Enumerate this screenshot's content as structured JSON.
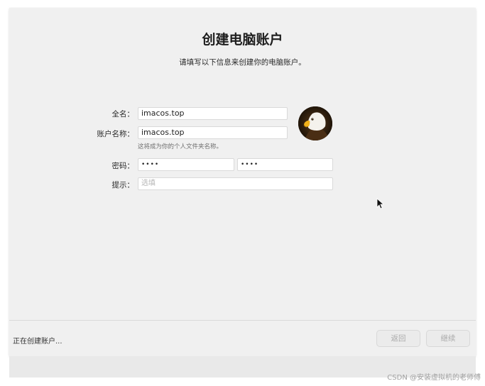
{
  "header": {
    "title": "创建电脑账户",
    "subtitle": "请填写以下信息来创建你的电脑账户。"
  },
  "form": {
    "fullname": {
      "label": "全名：",
      "value": "imacos.top"
    },
    "account": {
      "label": "账户名称：",
      "value": "imacos.top",
      "hint": "这将成为你的个人文件夹名称。"
    },
    "password": {
      "label": "密码：",
      "value": "••••",
      "verify_value": "••••"
    },
    "hint": {
      "label": "提示：",
      "placeholder": "选填"
    }
  },
  "avatar": {
    "icon": "eagle-avatar-icon"
  },
  "footer": {
    "status": "正在创建账户...",
    "back_label": "返回",
    "continue_label": "继续"
  },
  "watermark": "CSDN @安装虚拟机的老师傅"
}
